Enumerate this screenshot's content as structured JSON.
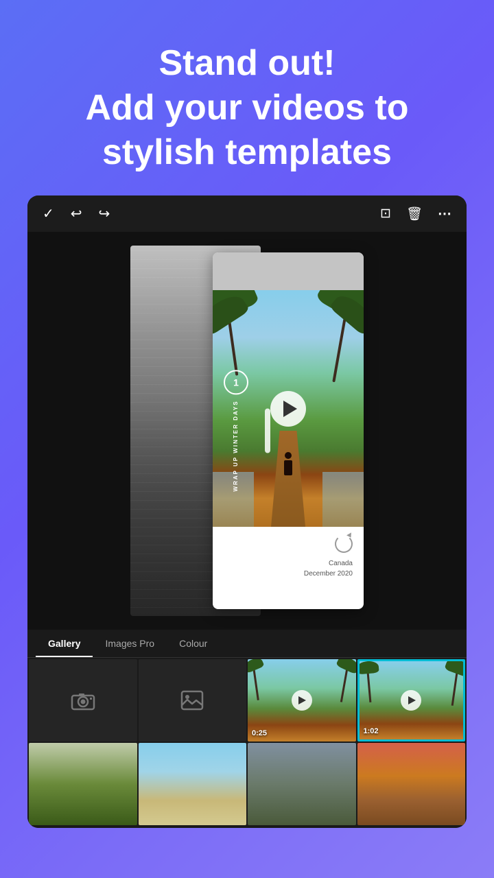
{
  "header": {
    "line1": "Stand out!",
    "line2": "Add your videos to",
    "line3": "stylish templates"
  },
  "toolbar": {
    "check_label": "✓",
    "undo_label": "↩",
    "redo_label": "↪",
    "crop_label": "⊡",
    "delete_label": "🗑",
    "more_label": "⋯"
  },
  "template": {
    "number": "1",
    "vertical_text_line1": "WRAP UP",
    "vertical_text_line2": "WINTER DAYS",
    "location": "Canada",
    "date": "December 2020"
  },
  "tabs": [
    {
      "label": "Gallery",
      "active": true
    },
    {
      "label": "Images Pro",
      "active": false
    },
    {
      "label": "Colour",
      "active": false
    }
  ],
  "media": {
    "row1": [
      {
        "type": "camera",
        "icon": "camera"
      },
      {
        "type": "gallery",
        "icon": "image"
      },
      {
        "type": "photo",
        "style": "palm",
        "duration": "0:25"
      },
      {
        "type": "photo",
        "style": "palm-selected",
        "duration": "1:02",
        "selected": true
      }
    ],
    "row2": [
      {
        "type": "photo",
        "style": "forest"
      },
      {
        "type": "photo",
        "style": "beach"
      },
      {
        "type": "photo",
        "style": "rocky"
      },
      {
        "type": "photo",
        "style": "sunset"
      }
    ]
  },
  "colors": {
    "background_gradient_start": "#5b6ef5",
    "background_gradient_end": "#8b7cf7",
    "editor_bg": "#1a1a1a",
    "selected_border": "#00bcd4",
    "toolbar_icon": "#ffffff",
    "tab_active": "#ffffff",
    "tab_inactive": "#aaaaaa"
  }
}
